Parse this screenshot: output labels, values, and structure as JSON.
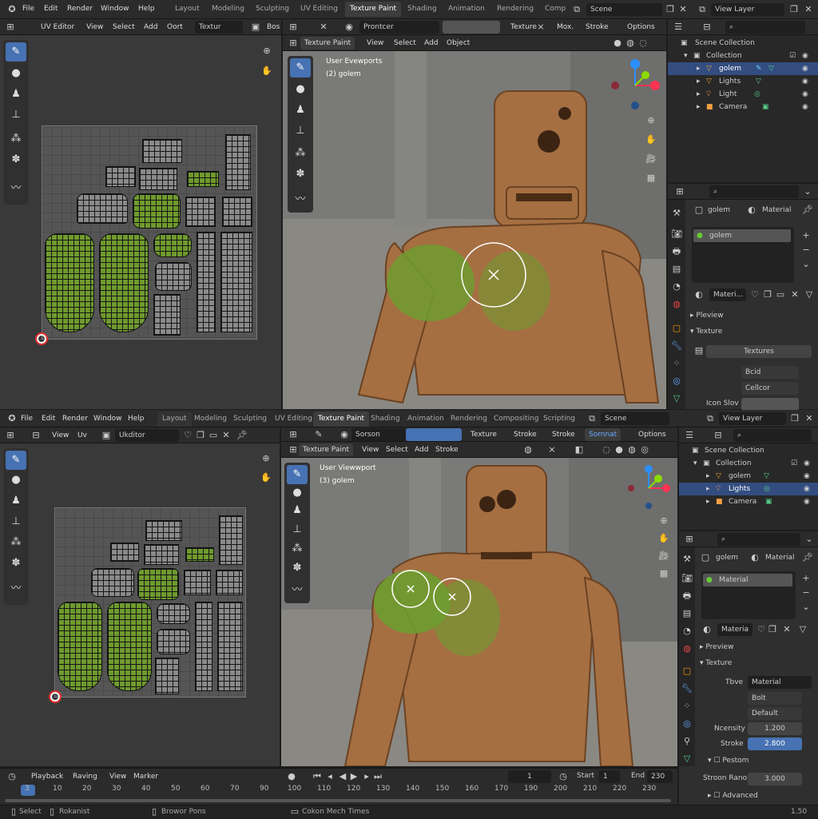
{
  "top": {
    "menu": [
      "File",
      "Edit",
      "Render",
      "Window",
      "Help"
    ],
    "tabs": [
      "Layout",
      "Modeling",
      "Sculpting",
      "UV Editing",
      "Texture Paint",
      "Shading",
      "Animation",
      "Rendering",
      "Comp"
    ],
    "active_tab": "Texture Paint",
    "scene": "Scene",
    "view_layer": "View Layer"
  },
  "uv1": {
    "editor": "UV Editor",
    "menus": [
      "View",
      "Select",
      "Add",
      "Oort"
    ],
    "texture": "Textur",
    "extra": "Bos"
  },
  "vp1": {
    "mode": "Texture Paint",
    "menus": [
      "View",
      "Select",
      "Add",
      "Object"
    ],
    "brush": "Prontcer",
    "texture": "Texture",
    "mode2": "Mox.",
    "stroke": "Stroke",
    "options": "Options",
    "overlay_line1": "User Evewports",
    "overlay_line2": "(2) golem"
  },
  "outliner1": {
    "root": "Scene Collection",
    "collection": "Collection",
    "items": [
      "golem",
      "Lights",
      "Light",
      "Camera"
    ]
  },
  "props1": {
    "object": "golem",
    "material": "Material",
    "slot": "golem",
    "mat_field": "Materi...",
    "preview": "Pleview",
    "texture": "Texture",
    "textures": "Textures",
    "opt1": "Bcid",
    "opt2": "Cellcor",
    "label": "Icon Slov"
  },
  "top2": {
    "menu": [
      "File",
      "Edit",
      "Render",
      "Window",
      "Help"
    ],
    "tabs": [
      "Layout",
      "Modeling",
      "Sculpting",
      "UV Editing",
      "Texture Paint",
      "Shading",
      "Animation",
      "Rendering",
      "Compositing",
      "Scripting"
    ],
    "active_tab": "Texture Paint",
    "scene": "Scene",
    "view_layer": "View Layer"
  },
  "uv2": {
    "menus": [
      "View",
      "Uv"
    ],
    "editor": "Ukditor"
  },
  "vp2": {
    "brush": "Sorson",
    "texture": "Texture",
    "stroke1": "Stroke",
    "stroke2": "Stroke",
    "sormat": "Sornnat",
    "options": "Options",
    "mode": "Texture Paint",
    "menus": [
      "View",
      "Select",
      "Add",
      "Stroke"
    ],
    "overlay_line1": "User Viewwport",
    "overlay_line2": "(3) golem"
  },
  "outliner2": {
    "root": "Scene Collection",
    "collection": "Collection",
    "items": [
      "golem",
      "Lights",
      "Camera"
    ]
  },
  "props2": {
    "object": "golem",
    "material": "Material",
    "slot": "Material",
    "mat_field": "Materia",
    "preview": "Preview",
    "texture": "Texture",
    "type_label": "Tbve",
    "type_value": "Material",
    "opt1": "Bolt",
    "opt2": "Default",
    "intensity_label": "Ncensity",
    "intensity_value": "1.200",
    "stroke_label": "Stroke",
    "stroke_value": "2.800",
    "pestom": "Pestom",
    "strong_label": "Stroon Rano",
    "strong_value": "3.000",
    "advanced": "Advanced"
  },
  "timeline": {
    "menus": [
      "Playback",
      "Raving",
      "View",
      "Marker"
    ],
    "current_frame": "1",
    "start_label": "Start",
    "start": "1",
    "end_label": "End",
    "end": "230",
    "ticks": [
      "3",
      "10",
      "20",
      "30",
      "40",
      "50",
      "60",
      "70",
      "90",
      "100",
      "110",
      "120",
      "130",
      "140",
      "150",
      "160",
      "170",
      "190",
      "200",
      "210",
      "220",
      "230"
    ]
  },
  "status": {
    "items": [
      "Select",
      "Rokanist",
      "Browor Pons",
      "Cokon Mech Times"
    ],
    "version": "1.50"
  }
}
